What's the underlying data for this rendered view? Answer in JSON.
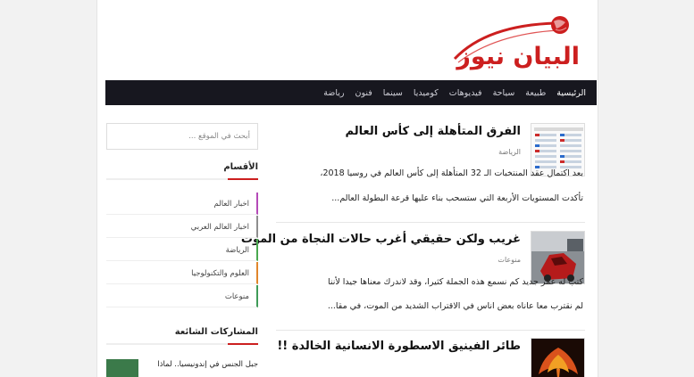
{
  "brand": {
    "logo_text": "البيان نيوز",
    "accent": "#cc1f1f"
  },
  "nav": {
    "items": [
      {
        "label": "الرئيسية"
      },
      {
        "label": "طبيعة"
      },
      {
        "label": "سياحة"
      },
      {
        "label": "فيديوهات"
      },
      {
        "label": "كوميديا"
      },
      {
        "label": "سينما"
      },
      {
        "label": "فنون"
      },
      {
        "label": "رياضة"
      }
    ]
  },
  "posts": [
    {
      "title": "الفرق المتأهلة إلى كأس العالم",
      "category": "الرياضة",
      "excerpt_1": "بعد اكتمال عقد المنتخبات الـ 32 المتأهلة إلى كأس العالم في روسيا 2018،",
      "excerpt_2": "تأكدت المستويات الأربعة التي ستسحب بناء عليها قرعة البطولة العالم...",
      "thumb_icon": "flags-table-icon"
    },
    {
      "title": "غريب ولكن حقيقي أغرب حالات النجاة من الموت",
      "category": "منوعات",
      "excerpt_1": "كتب له عمر جديد كم نسمع هذه الجملة كثيرا، وقد لاندرك معناها جيدا لأننا",
      "excerpt_2": "لم نقترب معا عاناه بعض اناس في الاقتراب الشديد من الموت، في مقا...",
      "thumb_icon": "crash-photo-icon"
    },
    {
      "title": "طائر الفينيق الاسطورة الانسانية الخالدة !!",
      "category": "",
      "excerpt_1": "",
      "excerpt_2": "",
      "thumb_icon": "phoenix-icon"
    }
  ],
  "sidebar": {
    "search_placeholder": "أبحث في الموقع ...",
    "categories_title": "الأقسام",
    "categories": [
      {
        "label": "اخبار العالم",
        "color": "#b44ab8"
      },
      {
        "label": "اخبار العالم العربي",
        "color": "#8e8e8e"
      },
      {
        "label": "الرياضة",
        "color": "#4aa84f"
      },
      {
        "label": "العلوم والتكنولوجيا",
        "color": "#e0862b"
      },
      {
        "label": "منوعات",
        "color": "#3f9b58"
      }
    ],
    "popular_title": "المشاركات الشائعة",
    "popular_text": "جبل الجنس في إندونيسيا.. لماذا"
  }
}
